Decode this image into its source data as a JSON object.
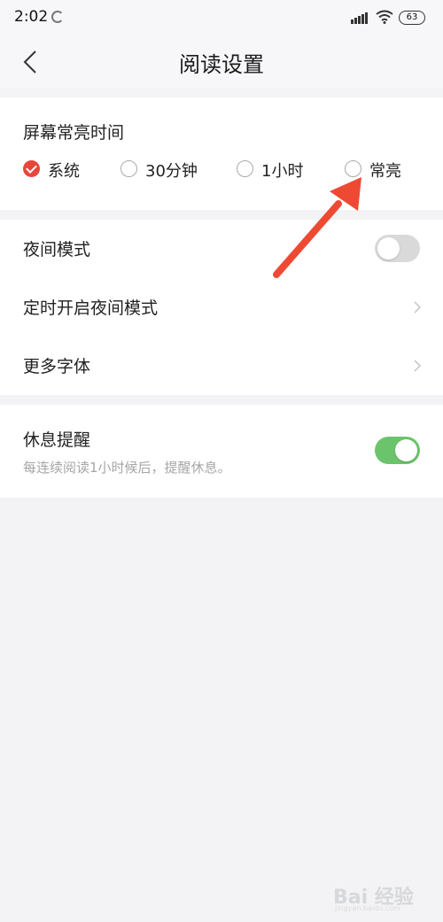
{
  "status_bar": {
    "time": "2:02",
    "battery": "63",
    "app_icon": "loading-circle-icon",
    "signal_icon": "cellular-signal-icon",
    "wifi_icon": "wifi-icon"
  },
  "header": {
    "title": "阅读设置",
    "back_icon": "chevron-left-icon"
  },
  "screen_timeout": {
    "title": "屏幕常亮时间",
    "options": [
      {
        "label": "系统",
        "checked": true
      },
      {
        "label": "30分钟",
        "checked": false
      },
      {
        "label": "1小时",
        "checked": false
      },
      {
        "label": "常亮",
        "checked": false
      }
    ]
  },
  "settings": {
    "night_mode": {
      "label": "夜间模式",
      "enabled": false
    },
    "scheduled_night_mode": {
      "label": "定时开启夜间模式"
    },
    "more_fonts": {
      "label": "更多字体"
    }
  },
  "rest_reminder": {
    "label": "休息提醒",
    "description": "每连续阅读1小时候后，提醒休息。",
    "enabled": true
  },
  "colors": {
    "accent_red": "#e8463a",
    "toggle_on": "#6bc46b",
    "toggle_off": "#d9d9d9",
    "annotation_arrow": "#ee4a33"
  },
  "watermark": {
    "text": "Bai 经验",
    "sub": "jingyan.baidu.com"
  }
}
